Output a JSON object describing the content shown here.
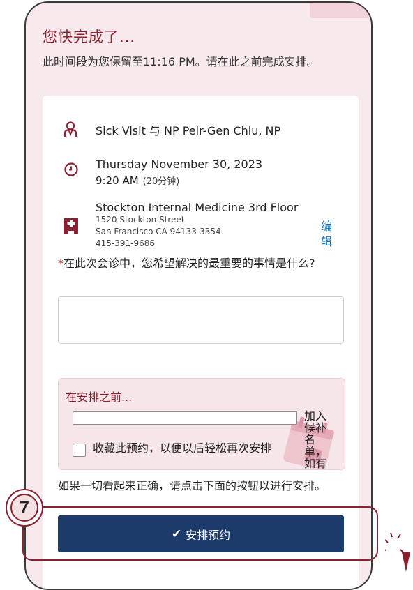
{
  "header": {
    "title": "您快完成了...",
    "subtitle": "此时间段为您保留至11:16 PM。请在此之前完成安排。"
  },
  "appointment": {
    "provider": "Sick Visit 与 NP Peir-Gen Chiu, NP",
    "date": "Thursday November 30, 2023",
    "time": "9:20 AM",
    "duration": "(20分钟)",
    "edit_label": "编辑",
    "location_name": "Stockton Internal Medicine 3rd Floor",
    "address_line1": "1520 Stockton Street",
    "address_line2": "San Francisco CA 94133-3354",
    "phone": "415-391-9686"
  },
  "question": {
    "required_mark": "*",
    "text": "在此次会诊中，您希望解决的最重要的事情是什么?",
    "answer_value": ""
  },
  "before_scheduling": {
    "title": "在安排之前...",
    "options": [
      {
        "label": "加入候补名单，如有更早的预约开放，您将收到通知",
        "checked": false
      },
      {
        "label": "收藏此预约，以便以后轻松再次安排",
        "checked": false
      }
    ]
  },
  "confirm_text": "如果一切看起来正确，请点击下面的按钮以进行安排。",
  "schedule_button": {
    "label": "安排预约",
    "icon": "check-icon"
  },
  "step_badge": "7",
  "colors": {
    "accent": "#8e1f30",
    "button": "#1c3b6b",
    "link": "#1f76b8",
    "background": "#f7e9ec"
  }
}
